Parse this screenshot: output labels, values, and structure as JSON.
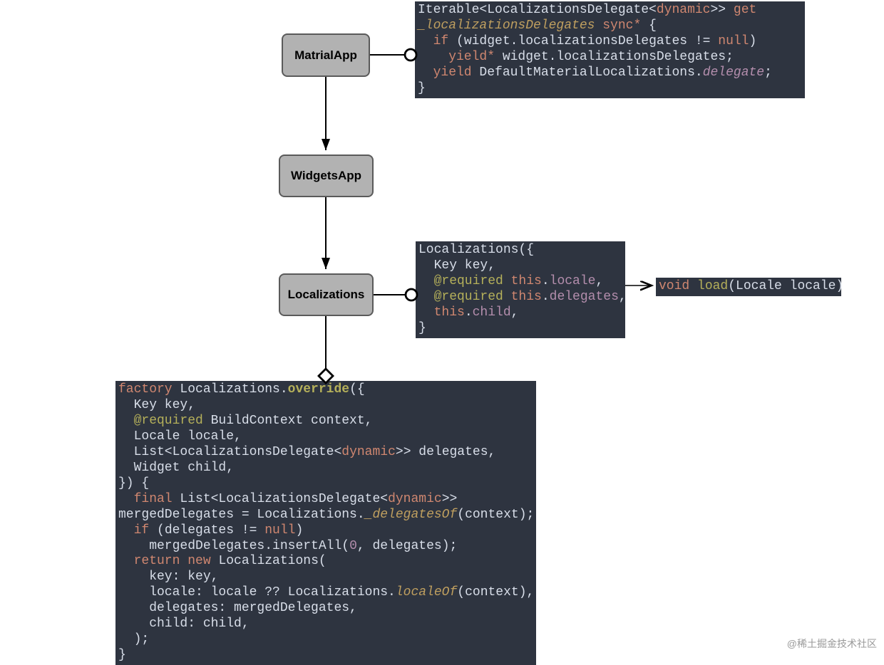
{
  "nodes": {
    "material": "MatrialApp",
    "widgets": "WidgetsApp",
    "localizations": "Localizations"
  },
  "code": {
    "box1": {
      "l1_a": "Iterable<LocalizationsDelegate<",
      "l1_b": "dynamic",
      "l1_c": ">> ",
      "l1_d": "get",
      "l2_a": "_localizationsDelegates",
      "l2_b": " sync*",
      "l2_c": " {",
      "l3_a": "  if",
      "l3_b": " (widget.localizationsDelegates != ",
      "l3_c": "null",
      "l3_d": ")",
      "l4_a": "    yield*",
      "l4_b": " widget.localizationsDelegates;",
      "l5_a": "  yield",
      "l5_b": " DefaultMaterialLocalizations.",
      "l5_c": "delegate",
      "l5_d": ";",
      "l6": "}"
    },
    "box2": {
      "l1": "Localizations({",
      "l2": "  Key key,",
      "l3_a": "  @required",
      "l3_b": " this",
      "l3_c": ".",
      "l3_d": "locale",
      "l3_e": ",",
      "l4_a": "  @required",
      "l4_b": " this",
      "l4_c": ".",
      "l4_d": "delegates",
      "l4_e": ",",
      "l5_a": "  this",
      "l5_b": ".",
      "l5_c": "child",
      "l5_d": ",",
      "l6": "}"
    },
    "box3": {
      "a": "void",
      "b": " load",
      "c": "(Locale locale)"
    },
    "box4": {
      "l1_a": "factory",
      "l1_b": " Localizations.",
      "l1_c": "override",
      "l1_d": "({",
      "l2": "  Key key,",
      "l3_a": "  @required",
      "l3_b": " BuildContext context,",
      "l4": "  Locale locale,",
      "l5_a": "  List<LocalizationsDelegate<",
      "l5_b": "dynamic",
      "l5_c": ">> delegates,",
      "l6": "  Widget child,",
      "l7": "}) {",
      "l8_a": "  final",
      "l8_b": " List<LocalizationsDelegate<",
      "l8_c": "dynamic",
      "l8_d": ">>",
      "l9_a": "mergedDelegates = Localizations.",
      "l9_b": "_delegatesOf",
      "l9_c": "(context);",
      "l10_a": "  if",
      "l10_b": " (delegates != ",
      "l10_c": "null",
      "l10_d": ")",
      "l11_a": "    mergedDelegates.insertAll(",
      "l11_b": "0",
      "l11_c": ", delegates);",
      "l12_a": "  return",
      "l12_b": " new",
      "l12_c": " Localizations(",
      "l13": "    key: key,",
      "l14_a": "    locale: locale ?? Localizations.",
      "l14_b": "localeOf",
      "l14_c": "(context),",
      "l15": "    delegates: mergedDelegates,",
      "l16": "    child: child,",
      "l17": "  );",
      "l18": "}"
    }
  },
  "watermark": "@稀土掘金技术社区"
}
